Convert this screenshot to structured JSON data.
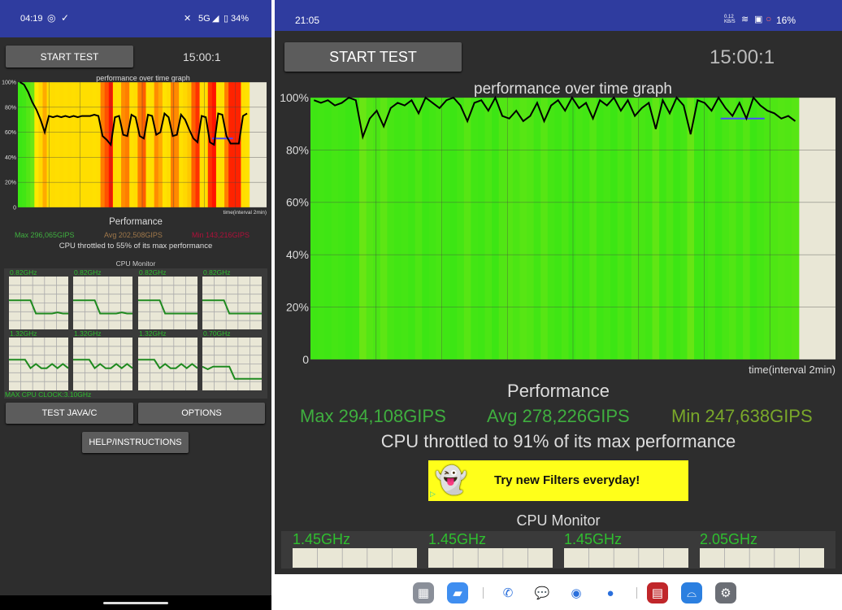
{
  "left": {
    "status": {
      "time": "04:19",
      "network": "5G",
      "battery": "34%"
    },
    "start_label": "START TEST",
    "timer": "15:00:1",
    "graph_title": "performance over time graph",
    "time_label": "time(interval 2min)",
    "performance_title": "Performance",
    "max": "Max 296,065GIPS",
    "avg": "Avg 202,508GIPS",
    "min": "Min 143,216GIPS",
    "throttle": "CPU throttled to 55% of its max performance",
    "cpu_monitor_title": "CPU Monitor",
    "cores": [
      {
        "freq": "0.82GHz",
        "history": [
          0.55,
          0.55,
          0.55,
          0.55,
          0.55,
          0.3,
          0.3,
          0.3,
          0.3,
          0.32,
          0.3,
          0.3
        ]
      },
      {
        "freq": "0.82GHz",
        "history": [
          0.55,
          0.55,
          0.55,
          0.55,
          0.55,
          0.3,
          0.3,
          0.3,
          0.3,
          0.32,
          0.3,
          0.3
        ]
      },
      {
        "freq": "0.82GHz",
        "history": [
          0.55,
          0.55,
          0.55,
          0.55,
          0.55,
          0.3,
          0.3,
          0.3,
          0.3,
          0.3,
          0.3,
          0.3
        ]
      },
      {
        "freq": "0.82GHz",
        "history": [
          0.55,
          0.55,
          0.55,
          0.55,
          0.55,
          0.3,
          0.3,
          0.3,
          0.3,
          0.3,
          0.3,
          0.3
        ]
      },
      {
        "freq": "1.32GHz",
        "history": [
          0.58,
          0.58,
          0.58,
          0.58,
          0.42,
          0.5,
          0.42,
          0.42,
          0.5,
          0.42,
          0.5,
          0.42
        ]
      },
      {
        "freq": "1.32GHz",
        "history": [
          0.58,
          0.58,
          0.58,
          0.58,
          0.42,
          0.5,
          0.42,
          0.42,
          0.5,
          0.42,
          0.5,
          0.42
        ]
      },
      {
        "freq": "1.32GHz",
        "history": [
          0.58,
          0.58,
          0.58,
          0.58,
          0.42,
          0.5,
          0.42,
          0.42,
          0.5,
          0.42,
          0.5,
          0.42
        ]
      },
      {
        "freq": "0.70GHz",
        "history": [
          0.45,
          0.4,
          0.45,
          0.45,
          0.45,
          0.45,
          0.22,
          0.22,
          0.22,
          0.22,
          0.22,
          0.22
        ]
      }
    ],
    "max_clock": "MAX CPU CLOCK:3.10GHz",
    "test_java_label": "TEST JAVA/C",
    "options_label": "OPTIONS",
    "help_label": "HELP/INSTRUCTIONS"
  },
  "right": {
    "status": {
      "time": "21:05",
      "net_speed": "0.12 KB/S",
      "battery": "16%"
    },
    "start_label": "START TEST",
    "timer": "15:00:1",
    "graph_title": "performance over time graph",
    "time_label": "time(interval 2min)",
    "performance_title": "Performance",
    "max": "Max 294,108GIPS",
    "avg": "Avg 278,226GIPS",
    "min": "Min 247,638GIPS",
    "throttle": "CPU throttled to 91% of its max performance",
    "ad_text": "Try new Filters everyday!",
    "cpu_monitor_title": "CPU Monitor",
    "cores": [
      {
        "freq": "1.45GHz"
      },
      {
        "freq": "1.45GHz"
      },
      {
        "freq": "1.45GHz"
      },
      {
        "freq": "2.05GHz"
      }
    ]
  },
  "dock": {
    "apps": [
      "app-drawer",
      "files",
      "phone",
      "messages",
      "chrome",
      "camera",
      "cpu-throttling-test",
      "glasses-app",
      "settings"
    ]
  },
  "colors": {
    "status_bar": "#2f3c9f",
    "background": "#2d2d2d",
    "max": "#3fae3f",
    "avg_left": "#a0784a",
    "avg_right": "#3fae3f",
    "min_left": "#b0103a",
    "min_right": "#7aa82a",
    "graph_bg": "#e9e7d6",
    "cpu_line": "#1f8a1f"
  },
  "chart_data": [
    {
      "type": "area",
      "title": "performance over time graph",
      "xlabel": "time(interval 2min)",
      "ylim": [
        0,
        100
      ],
      "yticks": [
        "0",
        "20%",
        "40%",
        "60%",
        "80%",
        "100%"
      ],
      "grid": true,
      "xlim_fraction_of_run": [
        0,
        1
      ],
      "series": [
        {
          "values": [
            100,
            98,
            92,
            84,
            78,
            70,
            60,
            73,
            72,
            73,
            72,
            73,
            72,
            73,
            72,
            73,
            73,
            73,
            74,
            73,
            57,
            54,
            50,
            72,
            73,
            58,
            57,
            74,
            72,
            57,
            55,
            74,
            73,
            58,
            60,
            75,
            72,
            57,
            58,
            74,
            70,
            62,
            55,
            52,
            73,
            72,
            52,
            50,
            75,
            74,
            57,
            51,
            51,
            51,
            73,
            75
          ]
        }
      ],
      "reference_line": 55
    },
    {
      "type": "area",
      "title": "performance over time graph",
      "xlabel": "time(interval 2min)",
      "ylim": [
        0,
        100
      ],
      "yticks": [
        "0",
        "20%",
        "40%",
        "60%",
        "80%",
        "100%"
      ],
      "grid": true,
      "series": [
        {
          "values": [
            99,
            98,
            99,
            97,
            98,
            100,
            99,
            85,
            92,
            95,
            89,
            96,
            98,
            97,
            99,
            94,
            100,
            98,
            96,
            99,
            100,
            97,
            91,
            98,
            99,
            95,
            100,
            93,
            92,
            95,
            91,
            93,
            98,
            91,
            97,
            99,
            95,
            100,
            96,
            98,
            92,
            99,
            97,
            100,
            95,
            99,
            93,
            96,
            98,
            88,
            99,
            94,
            100,
            97,
            86,
            99,
            98,
            95,
            100,
            96,
            93,
            98,
            92,
            100,
            97,
            95,
            94,
            92,
            93,
            91
          ]
        }
      ],
      "reference_line": 92
    }
  ]
}
